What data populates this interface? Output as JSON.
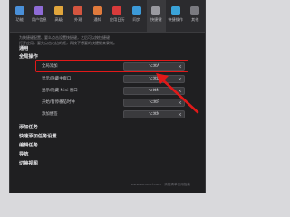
{
  "toolbar": {
    "items": [
      {
        "label": "功能",
        "icon": "grid-icon",
        "color": "#4a90d9"
      },
      {
        "label": "用户信息",
        "icon": "user-icon",
        "color": "#8e6bd6"
      },
      {
        "label": "高级",
        "icon": "star-icon",
        "color": "#e0a53c"
      },
      {
        "label": "外观",
        "icon": "palette-icon",
        "color": "#d4553f"
      },
      {
        "label": "通知",
        "icon": "bell-icon",
        "color": "#e07a3c"
      },
      {
        "label": "应用日历",
        "icon": "calendar-icon",
        "color": "#d83b3b"
      },
      {
        "label": "同步",
        "icon": "sync-icon",
        "color": "#3c9ad8"
      },
      {
        "label": "快捷键",
        "icon": "keyboard-icon",
        "color": "#9a9aa0"
      },
      {
        "label": "快捷操作",
        "icon": "bolt-icon",
        "color": "#3aa3d8"
      },
      {
        "label": "其他",
        "icon": "more-icon",
        "color": "#7a7a80"
      }
    ],
    "active_index": 7
  },
  "description": [
    "为快捷键配置、要么点击设置快捷键，之后可以按快捷键",
    "打开应用，要先点击右边的框，再按下想要的快捷键来录制。"
  ],
  "sections": {
    "general": "通用",
    "global_ops": "全局操作",
    "add_task": "添加任务",
    "quick_add": "快速添加任务设置",
    "edit_task": "编辑任务",
    "navigation": "导航",
    "switch_view": "切换视图"
  },
  "shortcuts": [
    {
      "label": "全局添加",
      "value": "⌥⌘A"
    },
    {
      "label": "显示/隐藏主窗口",
      "value": "⌥⌘D"
    },
    {
      "label": "显示/隐藏 Mini 窗口",
      "value": "⌥⌘M"
    },
    {
      "label": "开始/暂停番茄时钟",
      "value": "⌥⌘P"
    },
    {
      "label": "添加便签",
      "value": "⌥⌘N"
    }
  ],
  "watermark": "www.someurl.com · 滴答清单使用指南",
  "colors": {
    "highlight": "#e11919",
    "arrow": "#e11919"
  }
}
